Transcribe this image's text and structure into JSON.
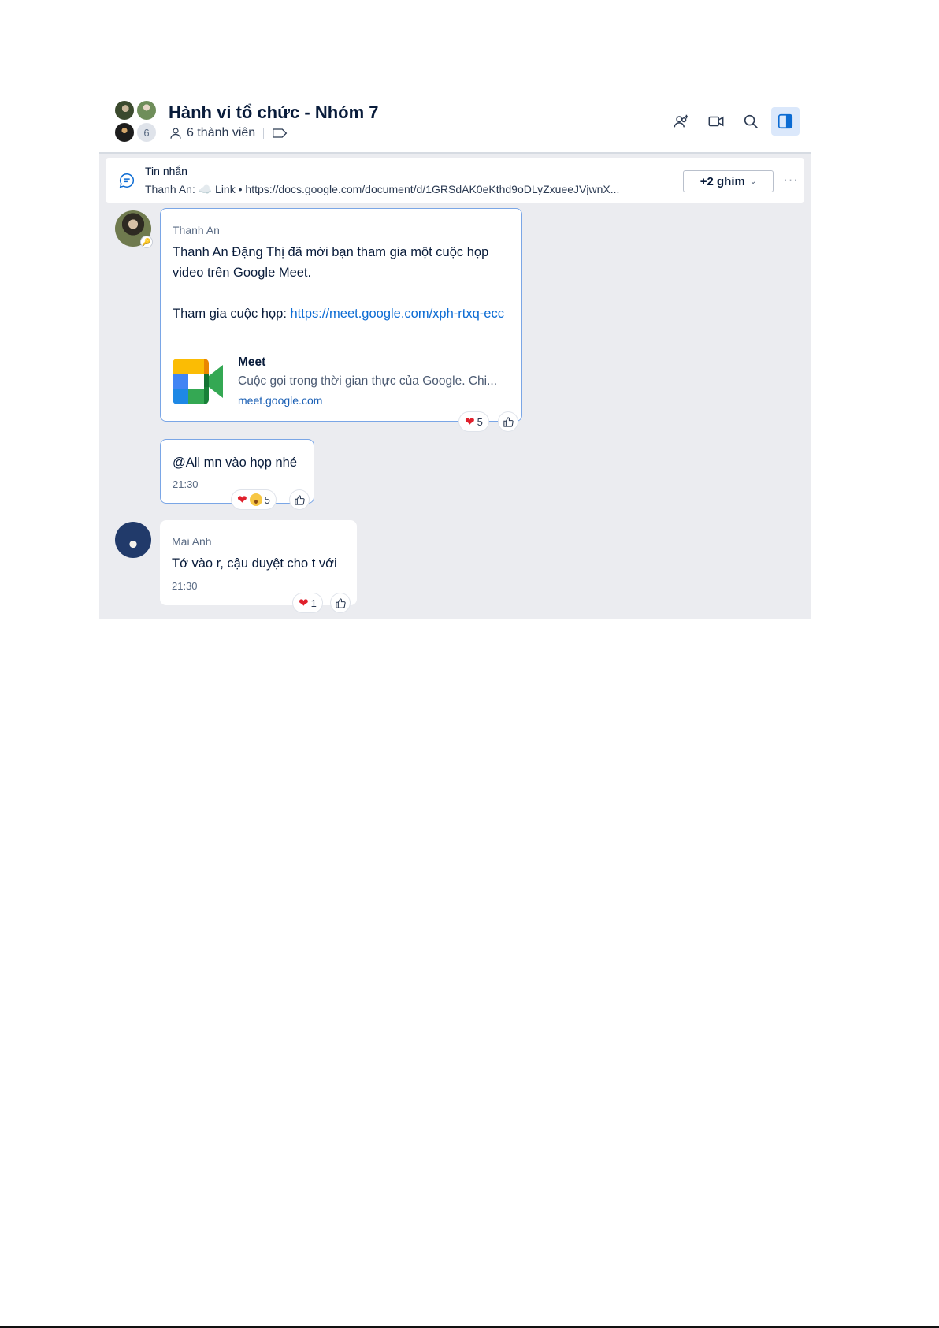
{
  "header": {
    "title": "Hành vi tổ chức - Nhóm 7",
    "member_count_badge": "6",
    "members_label": "6 thành viên"
  },
  "pinned": {
    "title": "Tin nhắn",
    "preview": "Thanh An: ☁️ Link • https://docs.google.com/document/d/1GRSdAK0eKthd9oDLyZxueeJVjwnX...",
    "pin_button": "+2 ghim",
    "more": "···"
  },
  "messages": [
    {
      "sender": "Thanh An",
      "text_line1": "Thanh An Đặng Thị đã mời bạn tham gia một cuộc họp video trên Google Meet.",
      "join_label": "Tham gia cuộc họp: ",
      "join_link": "https://meet.google.com/xph-rtxq-ecc",
      "preview_title": "Meet",
      "preview_desc": "Cuộc gọi trong thời gian thực của Google. Chi...",
      "preview_url": "meet.google.com",
      "reaction_count": "5"
    },
    {
      "text": "@All mn vào họp nhé",
      "time": "21:30",
      "reaction_count": "5"
    },
    {
      "sender": "Mai Anh",
      "text": "Tớ vào r, cậu duyệt cho t với",
      "time": "21:30",
      "reaction_count": "1"
    }
  ],
  "colors": {
    "accent": "#0b6bd3",
    "chat_bg": "#ebecf0",
    "heart": "#e0202c"
  },
  "icons": [
    "add-member-icon",
    "video-call-icon",
    "search-icon",
    "sidebar-toggle-icon",
    "message-icon",
    "heart-icon",
    "like-icon",
    "person-icon",
    "tag-icon"
  ]
}
